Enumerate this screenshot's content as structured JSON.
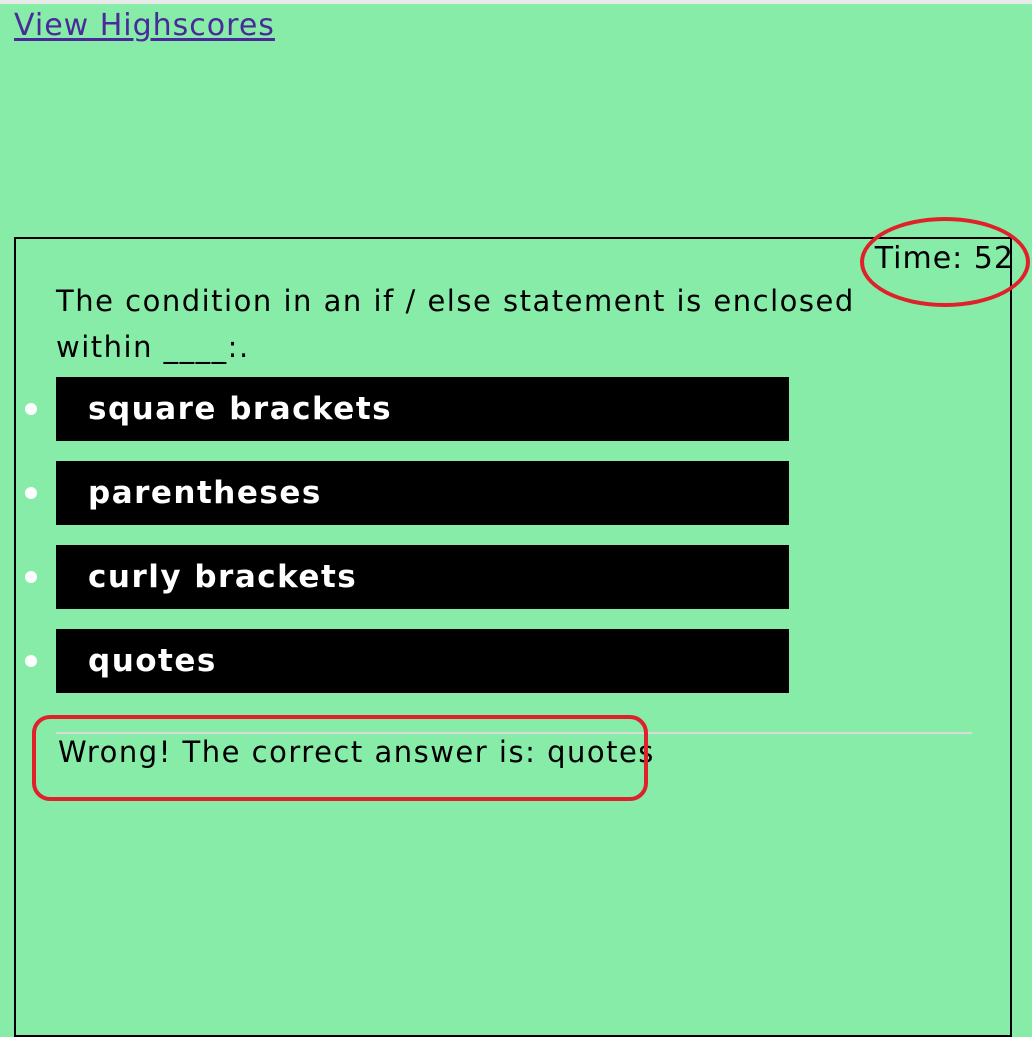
{
  "nav": {
    "highscores_link": "View Highscores"
  },
  "timer": {
    "label": "Time: 52",
    "seconds": 52
  },
  "question": {
    "text": "The condition in an if / else statement is enclosed within ____:."
  },
  "choices": [
    {
      "label": "square brackets"
    },
    {
      "label": "parentheses"
    },
    {
      "label": "curly brackets"
    },
    {
      "label": "quotes"
    }
  ],
  "feedback": {
    "text": "Wrong! The correct answer is: quotes"
  },
  "colors": {
    "background": "#86eca7",
    "button_bg": "#000000",
    "button_text": "#ffffff",
    "link": "#4a2a9a",
    "annotation": "#e0202a"
  }
}
